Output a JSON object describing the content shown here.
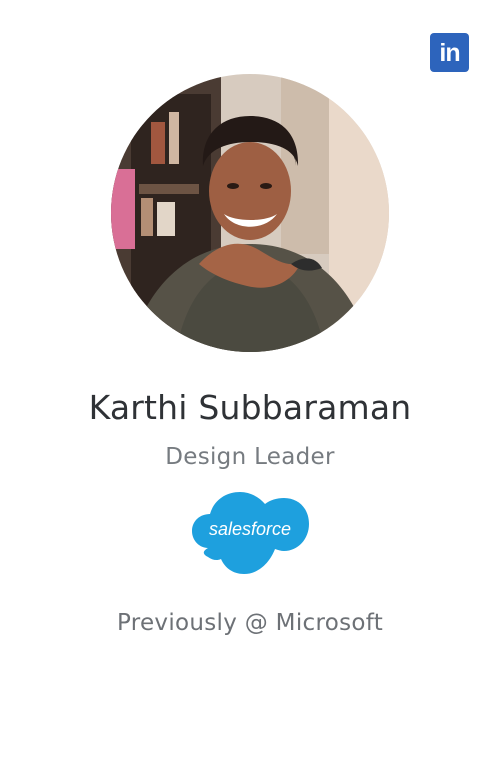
{
  "profile": {
    "name": "Karthi Subbaraman",
    "role": "Design Leader",
    "company_logo_text": "salesforce",
    "previous": "Previously @ Microsoft"
  },
  "social": {
    "linkedin_label": "in"
  },
  "colors": {
    "linkedin_blue": "#2d64bc",
    "salesforce_blue": "#1ea0de",
    "name_text": "#2f3236",
    "muted_text": "#767b80"
  },
  "icons": {
    "linkedin": "linkedin-icon",
    "avatar": "profile-photo"
  }
}
